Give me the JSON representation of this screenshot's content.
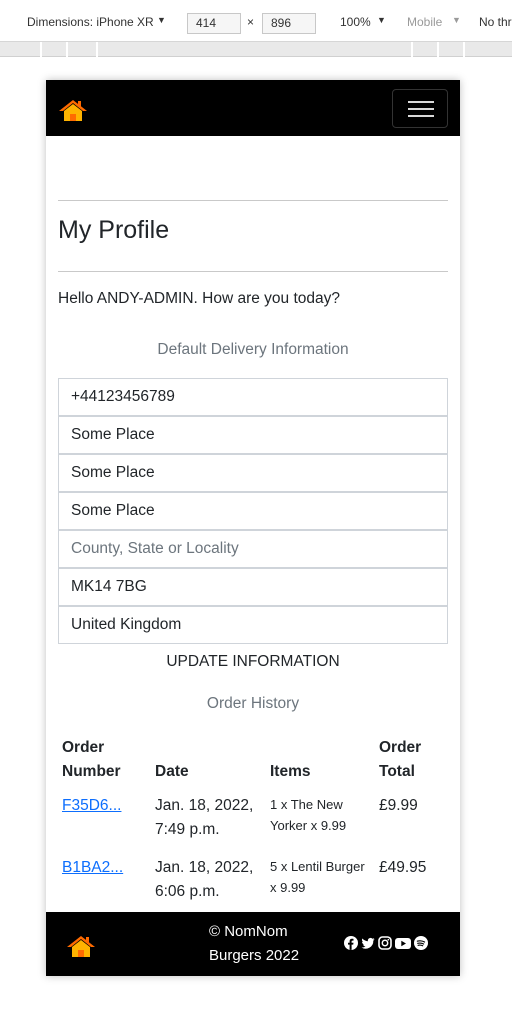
{
  "devtools": {
    "dimensions_label": "Dimensions: iPhone XR",
    "width": "414",
    "times": "×",
    "height": "896",
    "zoom": "100%",
    "device_mode": "Mobile",
    "throttling": "No thr"
  },
  "profile": {
    "title": "My Profile",
    "greeting": "Hello ANDY-ADMIN. How are you today?",
    "delivery_heading": "Default Delivery Information",
    "phone": "+44123456789",
    "street1": "Some Place",
    "street2": "Some Place",
    "town": "Some Place",
    "county_placeholder": "County, State or Locality",
    "postcode": "MK14 7BG",
    "country": "United Kingdom",
    "update_label": "UPDATE INFORMATION"
  },
  "orders": {
    "heading": "Order History",
    "col_number": "Order Number",
    "col_date": "Date",
    "col_items": "Items",
    "col_total": "Order Total",
    "rows": [
      {
        "number": "F35D6...",
        "date": "Jan. 18, 2022, 7:49 p.m.",
        "items": "1 x The New Yorker x 9.99",
        "total": "£9.99"
      },
      {
        "number": "B1BA2...",
        "date": "Jan. 18, 2022, 6:06 p.m.",
        "items": "5 x Lentil Burger x 9.99",
        "total": "£49.95"
      }
    ]
  },
  "footer": {
    "copyright": "© NomNom Burgers 2022"
  },
  "colors": {
    "navbar_bg": "#000000",
    "link": "#0d6efd",
    "muted": "#6c757d",
    "logo_roof": "#ff6a00",
    "logo_body": "#ffb300"
  },
  "icons": [
    "house-logo-icon",
    "menu-toggler-icon",
    "facebook-icon",
    "twitter-icon",
    "instagram-icon",
    "youtube-icon",
    "spotify-icon"
  ]
}
